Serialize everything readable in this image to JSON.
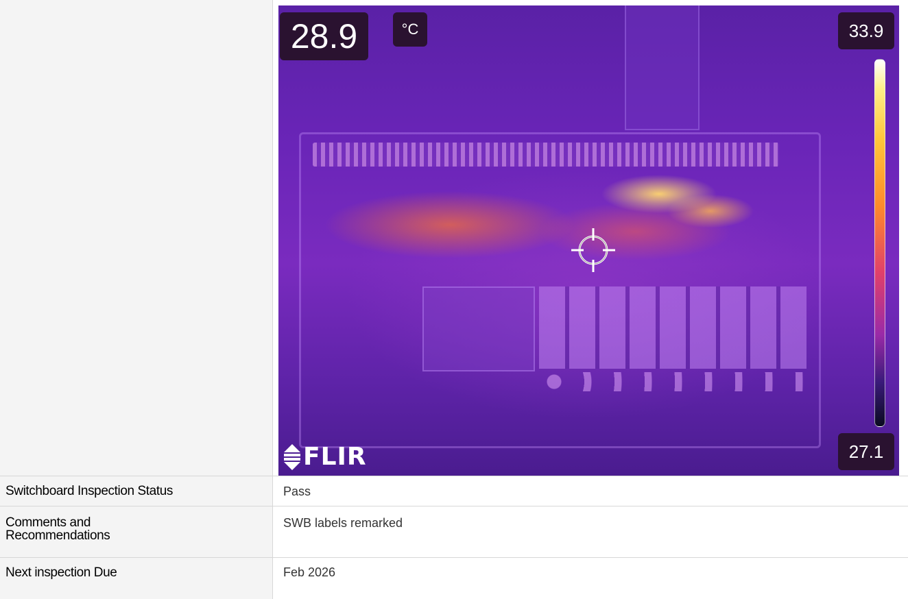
{
  "thermal_image": {
    "temperature_reading": "28.9",
    "unit": "°C",
    "scale_max": "33.9",
    "scale_min": "27.1",
    "brand": "FLIR",
    "palette_colors": [
      "#ffffff",
      "#ffc53a",
      "#e0406a",
      "#7a2bbf",
      "#0a0a20"
    ]
  },
  "rows": [
    {
      "label": "Switchboard Inspection Status",
      "value": "Pass"
    },
    {
      "label": "Comments and Recommendations",
      "value": "SWB labels remarked"
    },
    {
      "label": "Next inspection Due",
      "value": "Feb 2026"
    }
  ],
  "icons": {
    "crosshair": "crosshair-icon",
    "logo": "flir-logo-icon"
  }
}
